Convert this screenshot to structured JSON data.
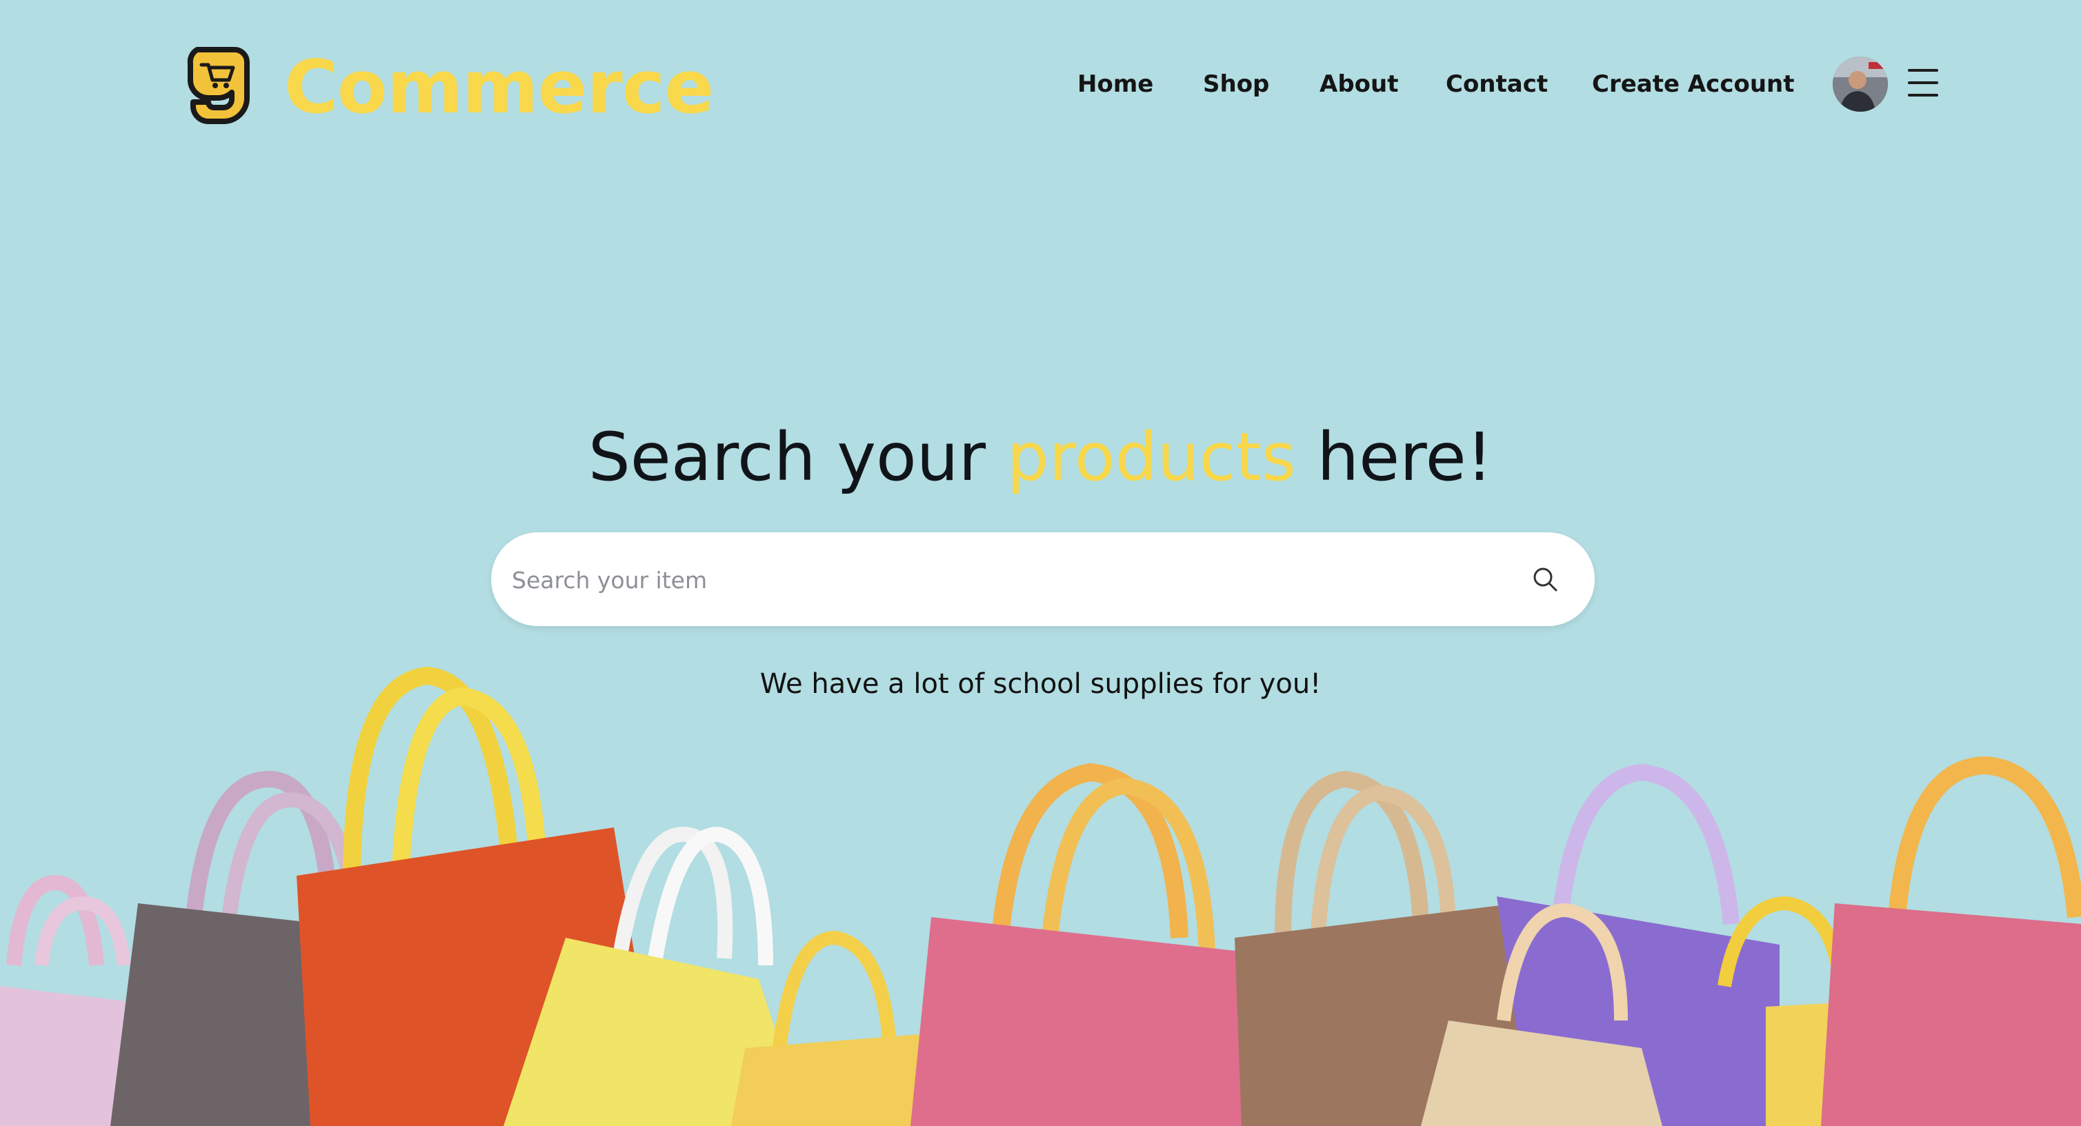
{
  "header": {
    "brand": "Commerce",
    "nav": [
      {
        "label": "Home"
      },
      {
        "label": "Shop"
      },
      {
        "label": "About"
      },
      {
        "label": "Contact"
      },
      {
        "label": "Create Account"
      }
    ]
  },
  "hero": {
    "title_before": "Search your ",
    "title_accent": "products",
    "title_after": " here!",
    "search_placeholder": "Search your item",
    "tagline": "We have a lot of school supplies for you!"
  },
  "icons": {
    "logo": "cart-logo-icon",
    "search": "search-icon",
    "menu": "hamburger-menu-icon",
    "avatar": "user-avatar"
  },
  "colors": {
    "background": "#b2dde2",
    "accent": "#f9d84b",
    "text": "#111111"
  }
}
